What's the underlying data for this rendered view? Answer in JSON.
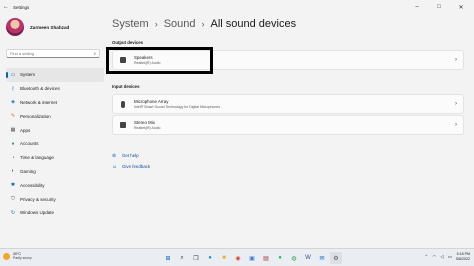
{
  "window": {
    "title": "Settings",
    "back_icon": "back-arrow-icon"
  },
  "profile": {
    "name": "Zarmeen Shahzad"
  },
  "search": {
    "placeholder": "Find a setting"
  },
  "nav": [
    {
      "label": "System",
      "icon": "laptop",
      "active": true
    },
    {
      "label": "Bluetooth & devices",
      "icon": "bluetooth"
    },
    {
      "label": "Network & internet",
      "icon": "wifi"
    },
    {
      "label": "Personalization",
      "icon": "brush"
    },
    {
      "label": "Apps",
      "icon": "apps"
    },
    {
      "label": "Accounts",
      "icon": "person"
    },
    {
      "label": "Time & language",
      "icon": "globe-clock"
    },
    {
      "label": "Gaming",
      "icon": "controller"
    },
    {
      "label": "Accessibility",
      "icon": "accessibility"
    },
    {
      "label": "Privacy & security",
      "icon": "shield"
    },
    {
      "label": "Windows Update",
      "icon": "update"
    }
  ],
  "breadcrumb": {
    "level1": "System",
    "level2": "Sound",
    "current": "All sound devices"
  },
  "output": {
    "header": "Output devices",
    "devices": [
      {
        "name": "Speakers",
        "sub": "Realtek(R) Audio"
      }
    ]
  },
  "input": {
    "header": "Input devices",
    "devices": [
      {
        "name": "Microphone Array",
        "sub": "Intel® Smart Sound Technology for Digital Microphones"
      },
      {
        "name": "Stereo Mix",
        "sub": "Realtek(R) Audio"
      }
    ]
  },
  "help": {
    "get_help": "Get help",
    "give_feedback": "Give feedback"
  },
  "taskbar": {
    "weather_temp": "40°C",
    "weather_desc": "Partly sunny",
    "time": "5:18 PM",
    "date": "5/8/2022"
  },
  "colors": {
    "accent": "#0067c0",
    "highlight_border": "#000000"
  }
}
